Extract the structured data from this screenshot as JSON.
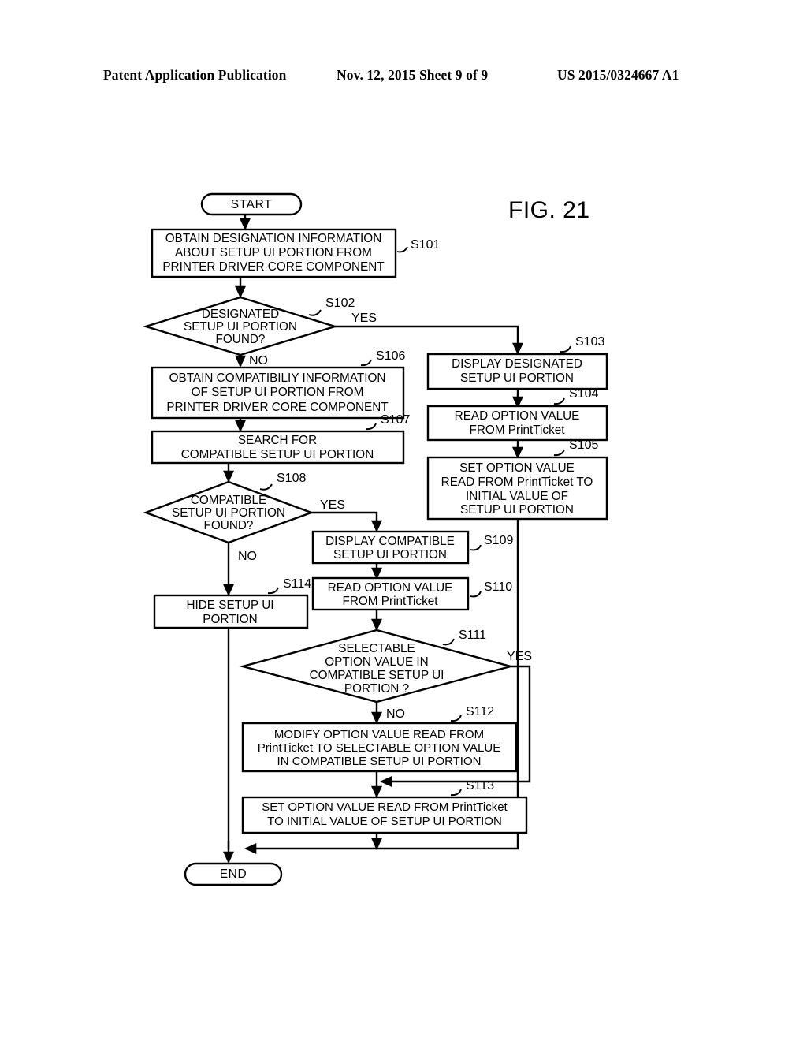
{
  "header": {
    "left": "Patent Application Publication",
    "middle": "Nov. 12, 2015  Sheet 9 of 9",
    "right": "US 2015/0324667 A1"
  },
  "figure": {
    "label": "FIG. 21"
  },
  "chart_data": {
    "type": "diagram",
    "diagram_type": "flowchart",
    "title": "FIG. 21",
    "nodes": [
      {
        "id": "start",
        "shape": "terminal",
        "step": "",
        "text": "START"
      },
      {
        "id": "s101",
        "shape": "process",
        "step": "S101",
        "text": "OBTAIN DESIGNATION INFORMATION ABOUT SETUP UI PORTION FROM PRINTER DRIVER CORE COMPONENT"
      },
      {
        "id": "s102",
        "shape": "decision",
        "step": "S102",
        "text": "DESIGNATED SETUP UI PORTION FOUND?"
      },
      {
        "id": "s103",
        "shape": "process",
        "step": "S103",
        "text": "DISPLAY DESIGNATED SETUP UI PORTION"
      },
      {
        "id": "s104",
        "shape": "process",
        "step": "S104",
        "text": "READ OPTION VALUE FROM PrintTicket"
      },
      {
        "id": "s105",
        "shape": "process",
        "step": "S105",
        "text": "SET OPTION VALUE READ FROM PrintTicket TO INITIAL VALUE OF SETUP UI PORTION"
      },
      {
        "id": "s106",
        "shape": "process",
        "step": "S106",
        "text": "OBTAIN COMPATIBILIY INFORMATION OF SETUP UI PORTION FROM PRINTER DRIVER CORE COMPONENT"
      },
      {
        "id": "s107",
        "shape": "process",
        "step": "S107",
        "text": "SEARCH FOR COMPATIBLE SETUP UI PORTION"
      },
      {
        "id": "s108",
        "shape": "decision",
        "step": "S108",
        "text": "COMPATIBLE SETUP UI PORTION FOUND?"
      },
      {
        "id": "s109",
        "shape": "process",
        "step": "S109",
        "text": "DISPLAY COMPATIBLE SETUP UI PORTION"
      },
      {
        "id": "s110",
        "shape": "process",
        "step": "S110",
        "text": "READ OPTION VALUE FROM PrintTicket"
      },
      {
        "id": "s111",
        "shape": "decision",
        "step": "S111",
        "text": "SELECTABLE OPTION VALUE IN COMPATIBLE SETUP UI PORTION ?"
      },
      {
        "id": "s112",
        "shape": "process",
        "step": "S112",
        "text": "MODIFY OPTION VALUE READ FROM PrintTicket TO SELECTABLE OPTION VALUE IN COMPATIBLE SETUP UI PORTION"
      },
      {
        "id": "s113",
        "shape": "process",
        "step": "S113",
        "text": "SET OPTION VALUE READ FROM PrintTicket TO INITIAL VALUE OF SETUP UI PORTION"
      },
      {
        "id": "s114",
        "shape": "process",
        "step": "S114",
        "text": "HIDE SETUP UI PORTION"
      },
      {
        "id": "end",
        "shape": "terminal",
        "step": "",
        "text": "END"
      }
    ],
    "edges": [
      {
        "from": "start",
        "to": "s101",
        "label": ""
      },
      {
        "from": "s101",
        "to": "s102",
        "label": ""
      },
      {
        "from": "s102",
        "to": "s103",
        "label": "YES"
      },
      {
        "from": "s102",
        "to": "s106",
        "label": "NO"
      },
      {
        "from": "s103",
        "to": "s104",
        "label": ""
      },
      {
        "from": "s104",
        "to": "s105",
        "label": ""
      },
      {
        "from": "s105",
        "to": "end",
        "label": ""
      },
      {
        "from": "s106",
        "to": "s107",
        "label": ""
      },
      {
        "from": "s107",
        "to": "s108",
        "label": ""
      },
      {
        "from": "s108",
        "to": "s109",
        "label": "YES"
      },
      {
        "from": "s108",
        "to": "s114",
        "label": "NO"
      },
      {
        "from": "s109",
        "to": "s110",
        "label": ""
      },
      {
        "from": "s110",
        "to": "s111",
        "label": ""
      },
      {
        "from": "s111",
        "to": "s113",
        "label": "YES"
      },
      {
        "from": "s111",
        "to": "s112",
        "label": "NO"
      },
      {
        "from": "s112",
        "to": "s113",
        "label": ""
      },
      {
        "from": "s113",
        "to": "end",
        "label": ""
      },
      {
        "from": "s114",
        "to": "end",
        "label": ""
      }
    ]
  },
  "nodes": {
    "start": {
      "text": "START"
    },
    "end": {
      "text": "END"
    },
    "s101": {
      "step": "S101",
      "l1": "OBTAIN DESIGNATION INFORMATION",
      "l2": "ABOUT SETUP UI PORTION FROM",
      "l3": "PRINTER DRIVER CORE COMPONENT"
    },
    "s102": {
      "step": "S102",
      "l1": "DESIGNATED",
      "l2": "SETUP UI PORTION",
      "l3": "FOUND?",
      "yes": "YES",
      "no": "NO"
    },
    "s103": {
      "step": "S103",
      "l1": "DISPLAY DESIGNATED",
      "l2": "SETUP UI PORTION"
    },
    "s104": {
      "step": "S104",
      "l1": "READ OPTION VALUE",
      "l2": "FROM PrintTicket"
    },
    "s105": {
      "step": "S105",
      "l1": "SET OPTION VALUE",
      "l2": "READ FROM PrintTicket TO",
      "l3": "INITIAL VALUE OF",
      "l4": "SETUP UI PORTION"
    },
    "s106": {
      "step": "S106",
      "l1": "OBTAIN COMPATIBILIY INFORMATION",
      "l2": "OF SETUP UI PORTION FROM",
      "l3": "PRINTER DRIVER CORE COMPONENT"
    },
    "s107": {
      "step": "S107",
      "l1": "SEARCH FOR",
      "l2": "COMPATIBLE SETUP UI PORTION"
    },
    "s108": {
      "step": "S108",
      "l1": "COMPATIBLE",
      "l2": "SETUP UI PORTION",
      "l3": "FOUND?",
      "yes": "YES",
      "no": "NO"
    },
    "s109": {
      "step": "S109",
      "l1": "DISPLAY COMPATIBLE",
      "l2": "SETUP UI PORTION"
    },
    "s110": {
      "step": "S110",
      "l1": "READ OPTION VALUE",
      "l2": "FROM PrintTicket"
    },
    "s111": {
      "step": "S111",
      "l1": "SELECTABLE",
      "l2": "OPTION VALUE IN",
      "l3": "COMPATIBLE SETUP UI",
      "l4": "PORTION ?",
      "yes": "YES",
      "no": "NO"
    },
    "s112": {
      "step": "S112",
      "l1": "MODIFY OPTION VALUE READ FROM",
      "l2": "PrintTicket TO SELECTABLE OPTION VALUE",
      "l3": "IN COMPATIBLE SETUP UI PORTION"
    },
    "s113": {
      "step": "S113",
      "l1": "SET OPTION VALUE READ FROM PrintTicket",
      "l2": "TO INITIAL VALUE OF SETUP UI PORTION"
    },
    "s114": {
      "step": "S114",
      "l1": "HIDE SETUP UI",
      "l2": "PORTION"
    }
  }
}
